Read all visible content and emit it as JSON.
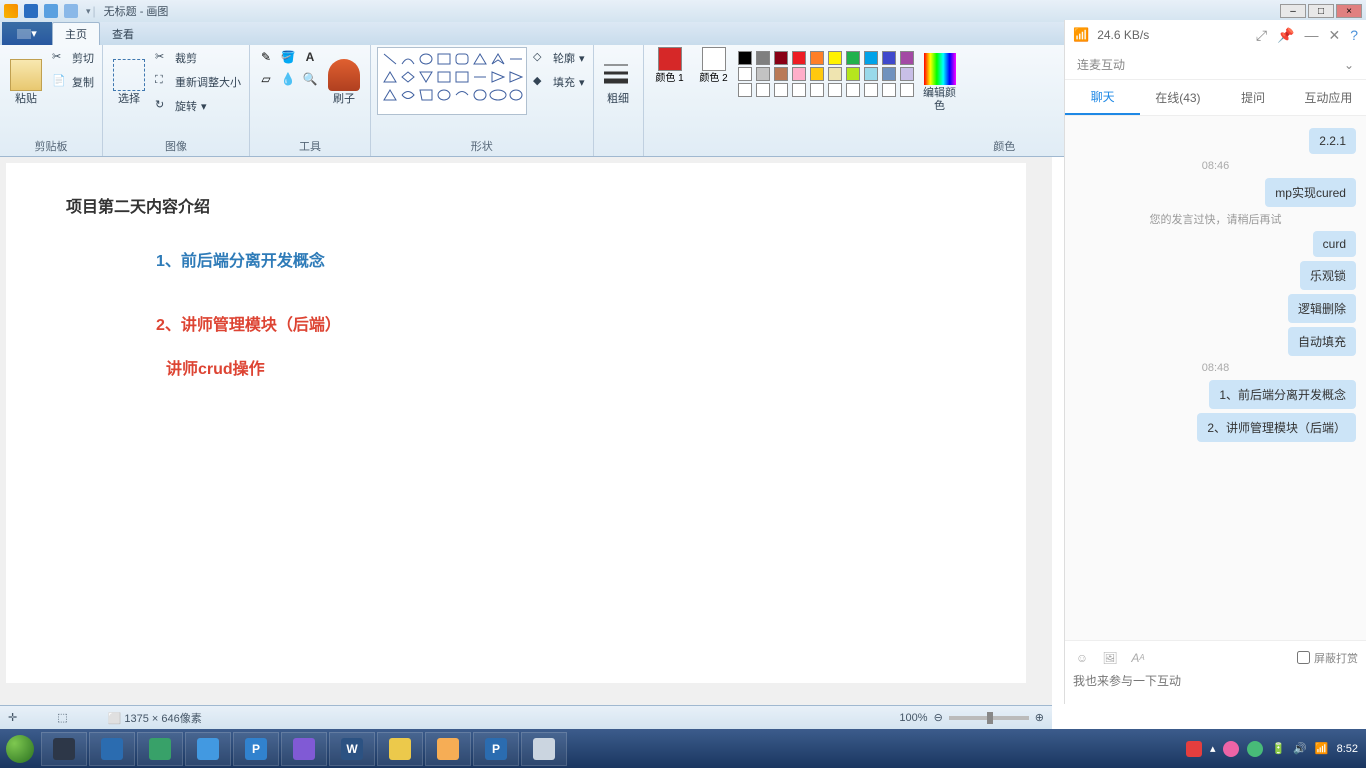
{
  "titlebar": {
    "title": "无标题 - 画图"
  },
  "ribbon": {
    "file": "",
    "tabs": {
      "home": "主页",
      "view": "查看"
    },
    "clipboard": {
      "label": "剪贴板",
      "paste": "粘贴",
      "cut": "剪切",
      "copy": "复制"
    },
    "image": {
      "label": "图像",
      "select": "选择",
      "crop": "裁剪",
      "resize": "重新调整大小",
      "rotate": "旋转"
    },
    "tools": {
      "label": "工具",
      "brush": "刷子"
    },
    "shapes": {
      "label": "形状",
      "outline": "轮廓",
      "fill": "填充"
    },
    "stroke": {
      "label": "粗细"
    },
    "colors": {
      "label": "颜色",
      "color1": "颜色 1",
      "color2": "颜色 2",
      "edit": "编辑颜色",
      "primary": "#d62828",
      "secondary": "#ffffff"
    }
  },
  "palette_row1": [
    "#000000",
    "#7f7f7f",
    "#880015",
    "#ed1c24",
    "#ff7f27",
    "#fff200",
    "#22b14c",
    "#00a2e8",
    "#3f48cc",
    "#a349a4"
  ],
  "palette_row2": [
    "#ffffff",
    "#c3c3c3",
    "#b97a57",
    "#ffaec9",
    "#ffc90e",
    "#efe4b0",
    "#b5e61d",
    "#99d9ea",
    "#7092be",
    "#c8bfe7"
  ],
  "canvas": {
    "heading": "项目第二天内容介绍",
    "line1": "1、前后端分离开发概念",
    "line2": "2、讲师管理模块（后端）",
    "line3": "讲师crud操作"
  },
  "statusbar": {
    "dimensions": "1375 × 646像素",
    "zoom": "100%"
  },
  "chat": {
    "speed": "24.6 KB/s",
    "header": "连麦互动",
    "tabs": {
      "chat": "聊天",
      "online": "在线(43)",
      "ask": "提问",
      "app": "互动应用"
    },
    "time1": "08:46",
    "time2": "08:48",
    "notice": "您的发言过快，请稍后再试",
    "msgs": {
      "m0": "2.2.1",
      "m1": "mp实现cured",
      "m2": "curd",
      "m3": "乐观锁",
      "m4": "逻辑删除",
      "m5": "自动填充",
      "m6": "1、前后端分离开发概念",
      "m7": "2、讲师管理模块（后端）"
    },
    "placeholder": "我也来参与一下互动",
    "fullscreen_text": "屏蔽打赏"
  },
  "taskbar": {
    "clock": "8:52"
  }
}
